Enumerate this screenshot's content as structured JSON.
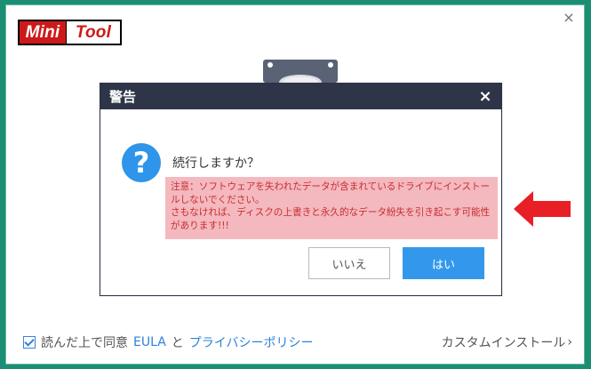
{
  "brand": {
    "left": "Mini",
    "right": "Tool"
  },
  "window": {
    "close_icon": "close-icon"
  },
  "dialog": {
    "title": "警告",
    "close_label": "×",
    "question_icon": "question-icon",
    "question_mark": "?",
    "confirm_text": "続行しますか？",
    "warning_text": "注意：ソフトウェアを失われたデータが含まれているドライブにインストールしないでください。\nさもなければ、ディスクの上書きと永久的なデータ紛失を引き起こす可能性があります!!!",
    "no_button": "いいえ",
    "yes_button": "はい"
  },
  "footer": {
    "agreement_prefix": "読んだ上で同意",
    "eula_label": "EULA",
    "connector": "と",
    "privacy_label": "プライバシーポリシー",
    "custom_install_label": "カスタムインストール",
    "custom_install_icon": "chevron-right-icon"
  },
  "colors": {
    "outer_background": "#1b8f73",
    "dialog_header": "#2e3548",
    "accent_blue": "#3398ec",
    "warning_bg": "#f4b8bf",
    "warning_text": "#c72e2e",
    "arrow_red": "#e81f25"
  }
}
